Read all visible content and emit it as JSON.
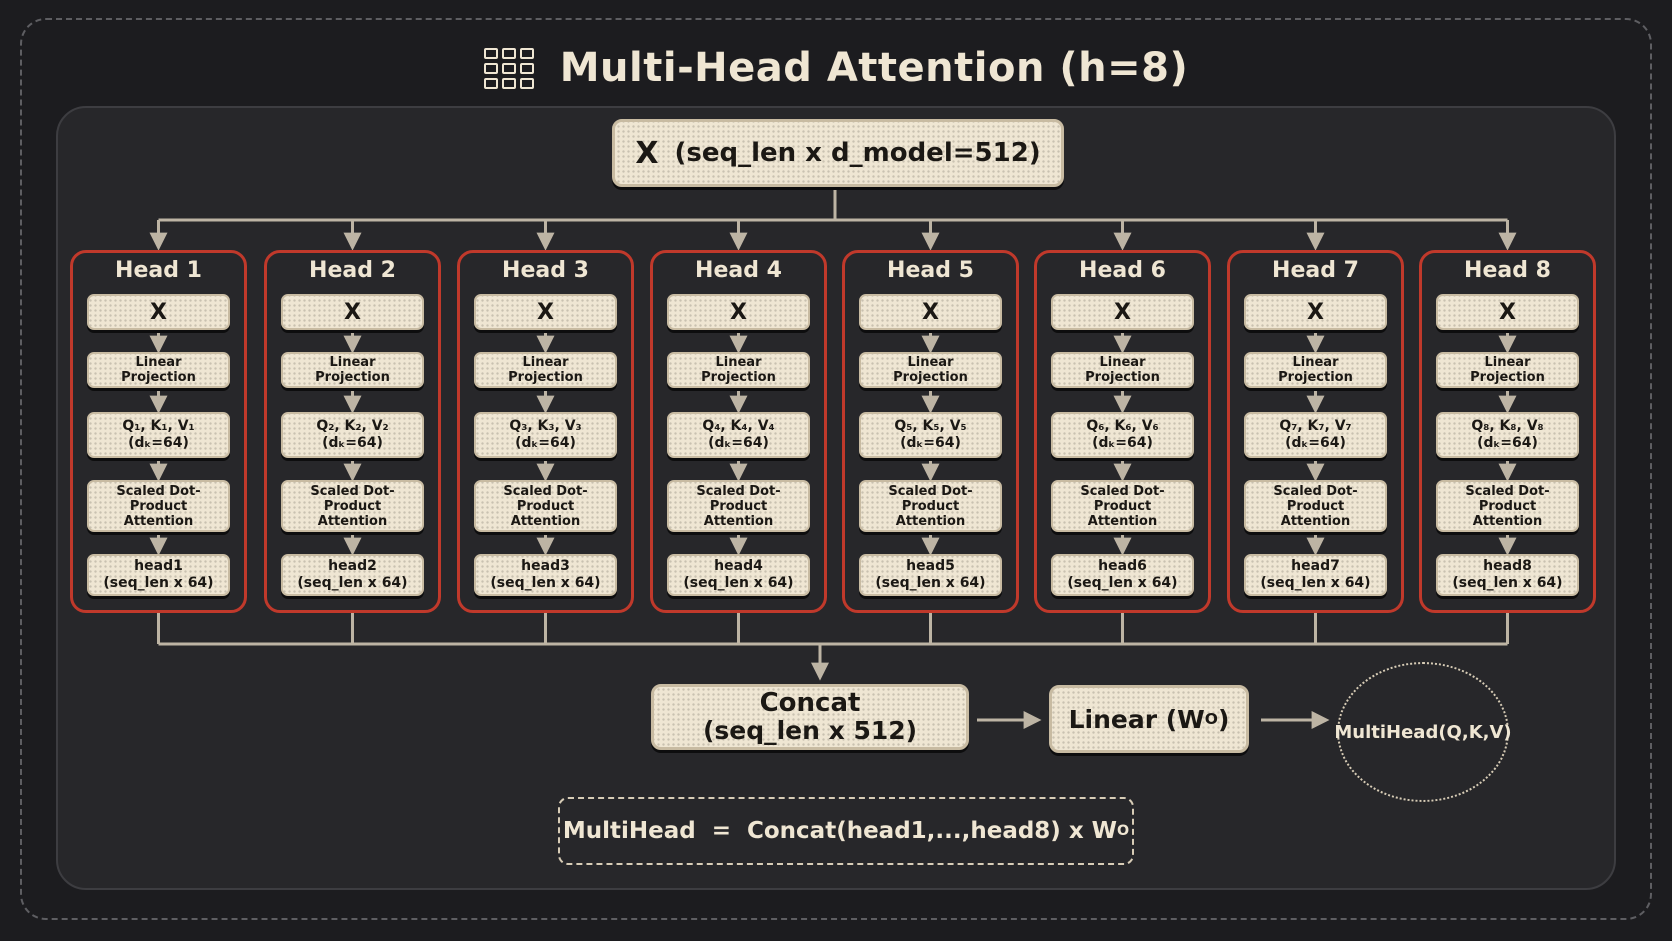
{
  "title": "Multi-Head Attention (h=8)",
  "input": {
    "symbol": "X",
    "shape": "(seq_len x d_model=512)"
  },
  "heads": [
    {
      "title": "Head 1",
      "input": "X",
      "projection": "Linear Projection",
      "qkv": "Q₁, K₁, V₁",
      "dk": "(dₖ=64)",
      "attention": "Scaled Dot-Product Attention",
      "output": "head1",
      "output_shape": "(seq_len x 64)"
    },
    {
      "title": "Head 2",
      "input": "X",
      "projection": "Linear Projection",
      "qkv": "Q₂, K₂, V₂",
      "dk": "(dₖ=64)",
      "attention": "Scaled Dot-Product Attention",
      "output": "head2",
      "output_shape": "(seq_len x 64)"
    },
    {
      "title": "Head 3",
      "input": "X",
      "projection": "Linear Projection",
      "qkv": "Q₃, K₃, V₃",
      "dk": "(dₖ=64)",
      "attention": "Scaled Dot-Product Attention",
      "output": "head3",
      "output_shape": "(seq_len x 64)"
    },
    {
      "title": "Head 4",
      "input": "X",
      "projection": "Linear Projection",
      "qkv": "Q₄, K₄, V₄",
      "dk": "(dₖ=64)",
      "attention": "Scaled Dot-Product Attention",
      "output": "head4",
      "output_shape": "(seq_len x 64)"
    },
    {
      "title": "Head 5",
      "input": "X",
      "projection": "Linear Projection",
      "qkv": "Q₅, K₅, V₅",
      "dk": "(dₖ=64)",
      "attention": "Scaled Dot-Product Attention",
      "output": "head5",
      "output_shape": "(seq_len x 64)"
    },
    {
      "title": "Head 6",
      "input": "X",
      "projection": "Linear Projection",
      "qkv": "Q₆, K₆, V₆",
      "dk": "(dₖ=64)",
      "attention": "Scaled Dot-Product Attention",
      "output": "head6",
      "output_shape": "(seq_len x 64)"
    },
    {
      "title": "Head 7",
      "input": "X",
      "projection": "Linear Projection",
      "qkv": "Q₇, K₇, V₇",
      "dk": "(dₖ=64)",
      "attention": "Scaled Dot-Product Attention",
      "output": "head7",
      "output_shape": "(seq_len x 64)"
    },
    {
      "title": "Head 8",
      "input": "X",
      "projection": "Linear Projection",
      "qkv": "Q₈, K₈, V₈",
      "dk": "(dₖ=64)",
      "attention": "Scaled Dot-Product Attention",
      "output": "head8",
      "output_shape": "(seq_len x 64)"
    }
  ],
  "concat": {
    "label": "Concat",
    "shape": "(seq_len x 512)"
  },
  "linear": {
    "label": "Linear (W",
    "superscript": "O",
    "close": ")"
  },
  "result": "MultiHead(Q,K,V)",
  "formula": {
    "text": "MultiHead  =  Concat(head1,...,head8) x W",
    "superscript": "O"
  },
  "colors": {
    "background": "#1c1c1f",
    "panel": "#27272a",
    "card": "#efe6d3",
    "head_border": "#c0392b",
    "wire": "#bdb4a4"
  },
  "icon": "grid-icon"
}
